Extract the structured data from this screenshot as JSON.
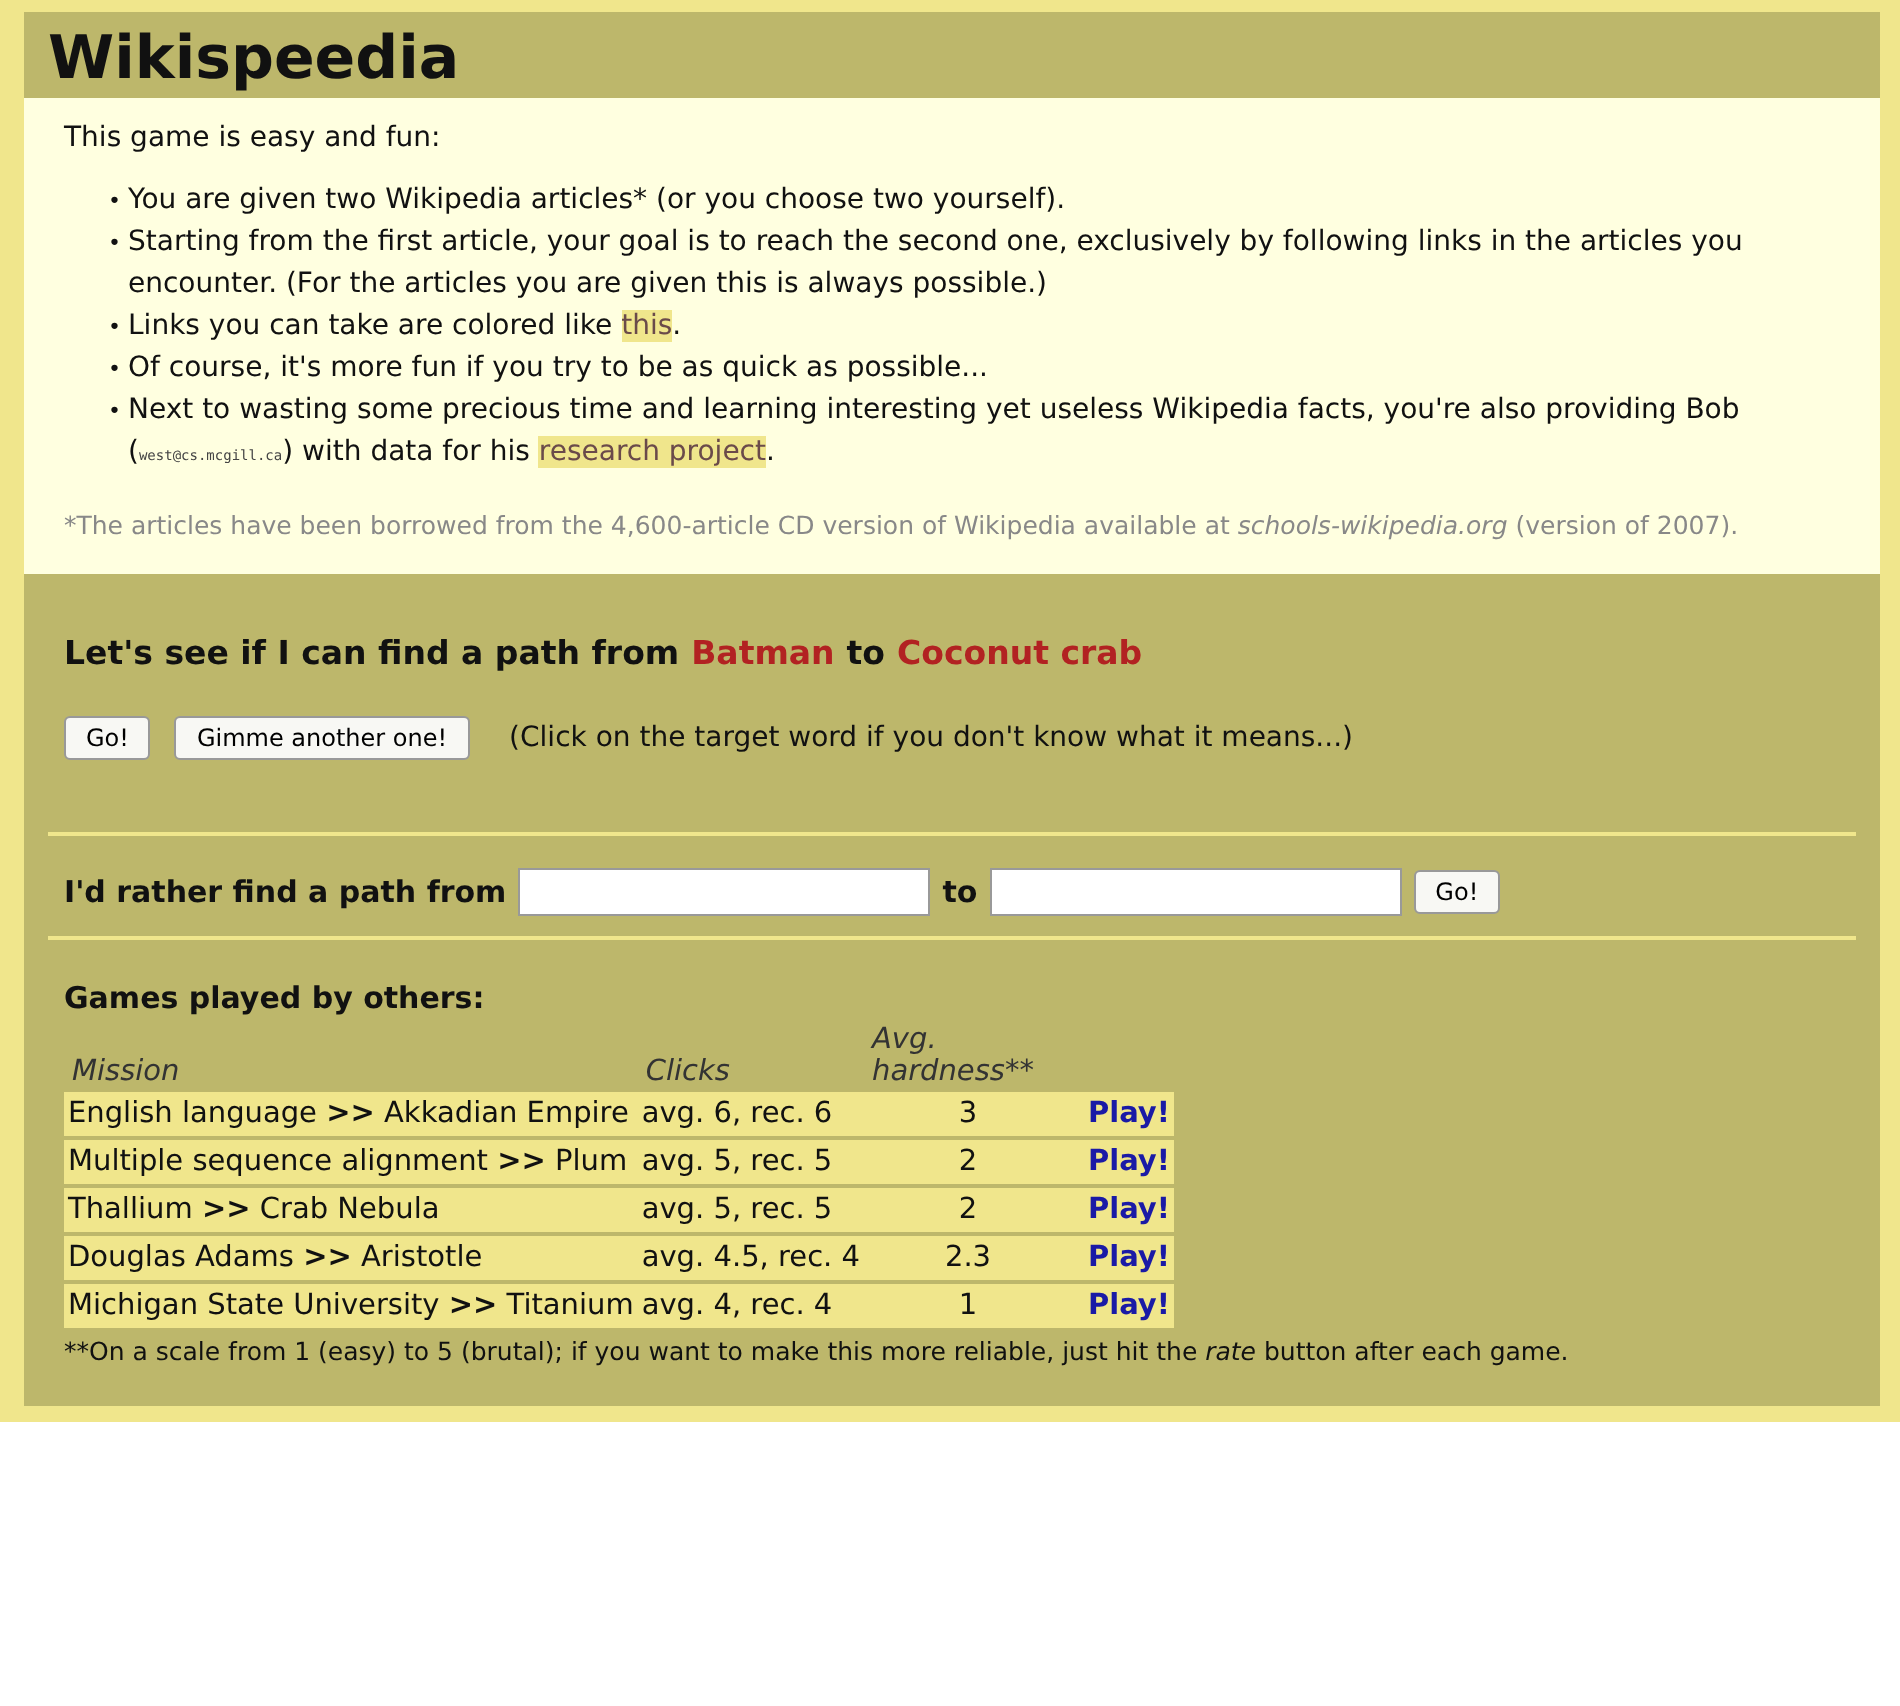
{
  "title": "Wikispeedia",
  "intro": "This game is easy and fun:",
  "rule_marker": "•",
  "rules": [
    [
      {
        "kind": "text",
        "text": "You are given two Wikipedia articles* (or you choose two yourself)."
      }
    ],
    [
      {
        "kind": "text",
        "text": "Starting from the first article, your goal is to reach the second one, exclusively by following links in the articles you encounter. (For the articles you are given this is always possible.)"
      }
    ],
    [
      {
        "kind": "text",
        "text": "Links you can take are colored like "
      },
      {
        "kind": "link",
        "text": "this"
      },
      {
        "kind": "text",
        "text": "."
      }
    ],
    [
      {
        "kind": "text",
        "text": "Of course, it's more fun if you try to be as quick as possible..."
      }
    ],
    [
      {
        "kind": "text",
        "text": "Next to wasting some precious time and learning interesting yet useless Wikipedia facts, you're also providing Bob ("
      },
      {
        "kind": "email",
        "text": "west@cs.mcgill.ca"
      },
      {
        "kind": "text",
        "text": ") with data for his "
      },
      {
        "kind": "link",
        "text": "research project"
      },
      {
        "kind": "text",
        "text": "."
      }
    ]
  ],
  "source_note": {
    "mark": "*",
    "text": "The articles have been borrowed from the 4,600-article CD version of Wikipedia available at *schools-wikipedia.org* (version of 2007)."
  },
  "challenge": {
    "lead": "Let's see if I can find a path from",
    "start": "Batman",
    "joiner": "to",
    "target": "Coconut crab"
  },
  "buttons": [
    "Go!",
    "Gimme another one!"
  ],
  "hint": "(Click on the target word if you don't know what it means...)",
  "custom": {
    "label": "I'd rather find a path from",
    "joiner": "to",
    "button": "Go!"
  },
  "games": {
    "heading": "Games played by others:",
    "columns": [
      "Mission",
      "Clicks",
      "Avg. hardness**"
    ],
    "rows": [
      {
        "mission": "English language **>>** Akkadian Empire",
        "clicks": "avg. 6, rec. 6",
        "hardness": "3",
        "action": "Play!"
      },
      {
        "mission": "Multiple sequence alignment **>>** Plum",
        "clicks": "avg. 5, rec. 5",
        "hardness": "2",
        "action": "Play!"
      },
      {
        "mission": "Thallium **>>** Crab Nebula",
        "clicks": "avg. 5, rec. 5",
        "hardness": "2",
        "action": "Play!"
      },
      {
        "mission": "Douglas Adams **>>** Aristotle",
        "clicks": "avg. 4.5, rec. 4",
        "hardness": "2.3",
        "action": "Play!"
      },
      {
        "mission": "Michigan State University **>>** Titanium",
        "clicks": "avg. 4, rec. 4",
        "hardness": "1",
        "action": "Play!"
      }
    ],
    "footnote": {
      "mark": "**",
      "text": "On a scale from 1 (easy) to 5 (brutal); if you want to make this more reliable, just hit the *rate* button after each game."
    }
  }
}
